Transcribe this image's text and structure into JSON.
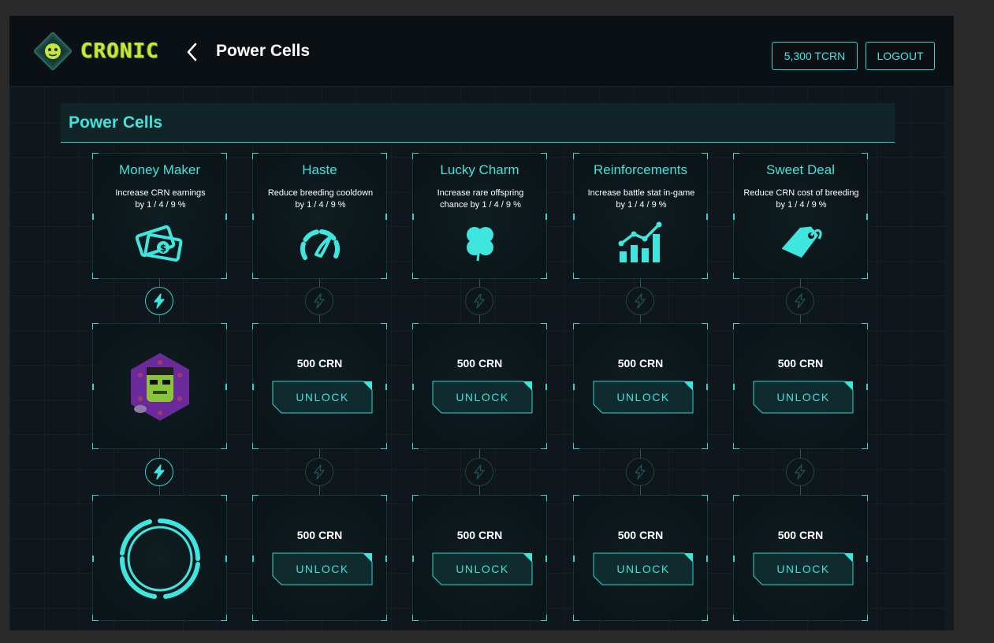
{
  "app": {
    "brand": "CRONIC",
    "page_title": "Power Cells"
  },
  "header": {
    "balance": "5,300 TCRN",
    "logout": "LOGOUT"
  },
  "section": {
    "title": "Power Cells"
  },
  "colors": {
    "accent": "#2fd5cf",
    "text_accent": "#40e3dc",
    "brand": "#c4e83a",
    "background": "#10171c"
  },
  "columns": [
    {
      "title": "Money Maker",
      "desc_line1": "Increase CRN earnings",
      "desc_line2": "by 1 / 4 / 9 %",
      "icon": "money-icon",
      "tiers": [
        {
          "state": "active",
          "price": ""
        },
        {
          "state": "active",
          "price": ""
        }
      ]
    },
    {
      "title": "Haste",
      "desc_line1": "Reduce breeding cooldown",
      "desc_line2": "by 1 / 4 / 9 %",
      "icon": "speedometer-icon",
      "tiers": [
        {
          "state": "locked",
          "price": "500 CRN",
          "action": "UNLOCK"
        },
        {
          "state": "locked",
          "price": "500 CRN",
          "action": "UNLOCK"
        }
      ]
    },
    {
      "title": "Lucky Charm",
      "desc_line1": "Increase rare offspring",
      "desc_line2": "chance by 1 / 4 / 9 %",
      "icon": "clover-icon",
      "tiers": [
        {
          "state": "locked",
          "price": "500 CRN",
          "action": "UNLOCK"
        },
        {
          "state": "locked",
          "price": "500 CRN",
          "action": "UNLOCK"
        }
      ]
    },
    {
      "title": "Reinforcements",
      "desc_line1": "Increase battle stat in-game",
      "desc_line2": "by 1 / 4 / 9 %",
      "icon": "chart-growth-icon",
      "tiers": [
        {
          "state": "locked",
          "price": "500 CRN",
          "action": "UNLOCK"
        },
        {
          "state": "locked",
          "price": "500 CRN",
          "action": "UNLOCK"
        }
      ]
    },
    {
      "title": "Sweet Deal",
      "desc_line1": "Reduce CRN cost of breeding",
      "desc_line2": "by 1 / 4 / 9 %",
      "icon": "price-tag-icon",
      "tiers": [
        {
          "state": "locked",
          "price": "500 CRN",
          "action": "UNLOCK"
        },
        {
          "state": "locked",
          "price": "500 CRN",
          "action": "UNLOCK"
        }
      ]
    }
  ]
}
